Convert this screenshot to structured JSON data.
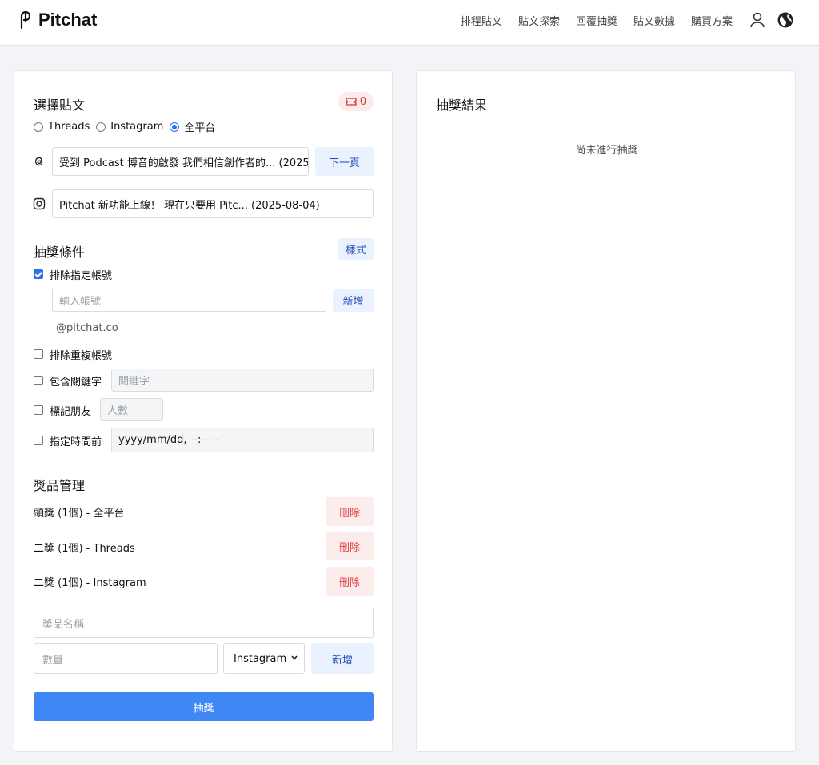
{
  "header": {
    "brand": "Pitchat",
    "nav": [
      "排程貼文",
      "貼文探索",
      "回覆抽獎",
      "貼文數據",
      "購買方案"
    ]
  },
  "select_post": {
    "title": "選擇貼文",
    "ticket_count": "0",
    "platforms": [
      {
        "label": "Threads",
        "selected": false
      },
      {
        "label": "Instagram",
        "selected": false
      },
      {
        "label": "全平台",
        "selected": true
      }
    ],
    "threads_post": "受到 Podcast 博音的啟發 我們相信創作者的... (2025",
    "next_page_label": "下一頁",
    "instagram_post": "Pitchat 新功能上線！ 現在只要用 Pitc... (2025-08-04)"
  },
  "conditions": {
    "title": "抽獎條件",
    "style_label": "樣式",
    "exclude_accounts_label": "排除指定帳號",
    "exclude_accounts_checked": true,
    "account_placeholder": "輸入帳號",
    "add_label": "新增",
    "excluded_account": "@pitchat.co",
    "exclude_duplicate_label": "排除重複帳號",
    "keyword_label": "包含關鍵字",
    "keyword_placeholder": "關鍵字",
    "tag_friends_label": "標記朋友",
    "tag_friends_placeholder": "人數",
    "before_time_label": "指定時間前",
    "datetime_value": "yyyy/mm/dd, --:-- --"
  },
  "prizes": {
    "title": "獎品管理",
    "items": [
      {
        "label": "頭獎 (1個) - 全平台"
      },
      {
        "label": "二獎 (1個) - Threads"
      },
      {
        "label": "二獎 (1個) - Instagram"
      }
    ],
    "delete_label": "刪除",
    "name_placeholder": "獎品名稱",
    "qty_placeholder": "數量",
    "platform_selected": "Instagram",
    "add_label": "新增"
  },
  "draw_label": "抽獎",
  "results": {
    "title": "抽獎結果",
    "empty": "尚未進行抽獎"
  },
  "colors": {
    "primary": "#3f87f5",
    "danger": "#e04444",
    "soft_blue": "#eaf2ff"
  }
}
